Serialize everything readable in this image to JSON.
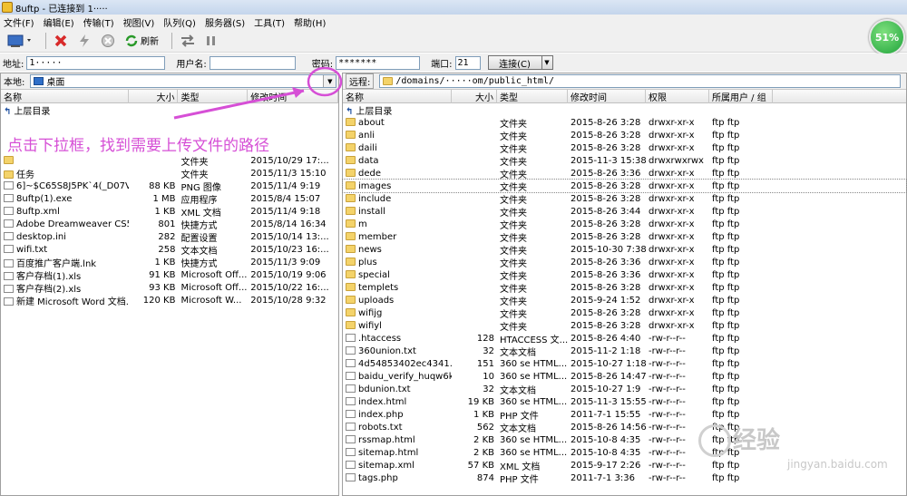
{
  "window": {
    "title": "8uftp - 已连接到 1·····"
  },
  "menu": [
    "文件(F)",
    "编辑(E)",
    "传输(T)",
    "视图(V)",
    "队列(Q)",
    "服务器(S)",
    "工具(T)",
    "帮助(H)"
  ],
  "toolbar": {
    "refresh_label": "刷新",
    "progress": "51%"
  },
  "connection": {
    "address_label": "地址:",
    "address_value": "1·····",
    "user_label": "用户名:",
    "user_value": "",
    "password_label": "密码:",
    "password_value": "*******",
    "port_label": "端口:",
    "port_value": "21",
    "connect_label": "连接(C)"
  },
  "local": {
    "label": "本地:",
    "path": "桌面",
    "columns": [
      "名称",
      "大小",
      "类型",
      "修改时间"
    ],
    "up_label": "上层目录",
    "files": [
      {
        "name": "",
        "size": "",
        "type": "文件夹",
        "date": "2015/10/29 17:..."
      },
      {
        "name": "任务",
        "size": "",
        "type": "文件夹",
        "date": "2015/11/3 15:10"
      },
      {
        "name": "6]~$C65S8J5PK`4(_D07V4...",
        "size": "88 KB",
        "type": "PNG 图像",
        "date": "2015/11/4 9:19"
      },
      {
        "name": "8uftp(1).exe",
        "size": "1 MB",
        "type": "应用程序",
        "date": "2015/8/4 15:07"
      },
      {
        "name": "8uftp.xml",
        "size": "1 KB",
        "type": "XML 文档",
        "date": "2015/11/4 9:18"
      },
      {
        "name": "Adobe Dreamweaver CS5...",
        "size": "801",
        "type": "快捷方式",
        "date": "2015/8/14 16:34"
      },
      {
        "name": "desktop.ini",
        "size": "282",
        "type": "配置设置",
        "date": "2015/10/14 13:..."
      },
      {
        "name": "wifi.txt",
        "size": "258",
        "type": "文本文档",
        "date": "2015/10/23 16:..."
      },
      {
        "name": "百度推广客户端.lnk",
        "size": "1 KB",
        "type": "快捷方式",
        "date": "2015/11/3 9:09"
      },
      {
        "name": "客户存档(1).xls",
        "size": "91 KB",
        "type": "Microsoft Off...",
        "date": "2015/10/19 9:06"
      },
      {
        "name": "客户存档(2).xls",
        "size": "93 KB",
        "type": "Microsoft Off...",
        "date": "2015/10/22 16:..."
      },
      {
        "name": "新建 Microsoft Word 文档...",
        "size": "120 KB",
        "type": "Microsoft W...",
        "date": "2015/10/28 9:32"
      }
    ]
  },
  "remote": {
    "label": "远程:",
    "path": "/domains/·····om/public_html/",
    "columns": [
      "名称",
      "大小",
      "类型",
      "修改时间",
      "权限",
      "所属用户 / 组"
    ],
    "up_label": "上层目录",
    "files": [
      {
        "name": "about",
        "size": "",
        "type": "文件夹",
        "date": "2015-8-26 3:28",
        "perm": "drwxr-xr-x",
        "owner": "ftp ftp",
        "folder": true
      },
      {
        "name": "anli",
        "size": "",
        "type": "文件夹",
        "date": "2015-8-26 3:28",
        "perm": "drwxr-xr-x",
        "owner": "ftp ftp",
        "folder": true
      },
      {
        "name": "daili",
        "size": "",
        "type": "文件夹",
        "date": "2015-8-26 3:28",
        "perm": "drwxr-xr-x",
        "owner": "ftp ftp",
        "folder": true
      },
      {
        "name": "data",
        "size": "",
        "type": "文件夹",
        "date": "2015-11-3 15:38",
        "perm": "drwxrwxrwx",
        "owner": "ftp ftp",
        "folder": true
      },
      {
        "name": "dede",
        "size": "",
        "type": "文件夹",
        "date": "2015-8-26 3:36",
        "perm": "drwxr-xr-x",
        "owner": "ftp ftp",
        "folder": true
      },
      {
        "name": "images",
        "size": "",
        "type": "文件夹",
        "date": "2015-8-26 3:28",
        "perm": "drwxr-xr-x",
        "owner": "ftp ftp",
        "folder": true
      },
      {
        "name": "include",
        "size": "",
        "type": "文件夹",
        "date": "2015-8-26 3:28",
        "perm": "drwxr-xr-x",
        "owner": "ftp ftp",
        "folder": true
      },
      {
        "name": "install",
        "size": "",
        "type": "文件夹",
        "date": "2015-8-26 3:44",
        "perm": "drwxr-xr-x",
        "owner": "ftp ftp",
        "folder": true
      },
      {
        "name": "m",
        "size": "",
        "type": "文件夹",
        "date": "2015-8-26 3:28",
        "perm": "drwxr-xr-x",
        "owner": "ftp ftp",
        "folder": true
      },
      {
        "name": "member",
        "size": "",
        "type": "文件夹",
        "date": "2015-8-26 3:28",
        "perm": "drwxr-xr-x",
        "owner": "ftp ftp",
        "folder": true
      },
      {
        "name": "news",
        "size": "",
        "type": "文件夹",
        "date": "2015-10-30 7:38",
        "perm": "drwxr-xr-x",
        "owner": "ftp ftp",
        "folder": true
      },
      {
        "name": "plus",
        "size": "",
        "type": "文件夹",
        "date": "2015-8-26 3:36",
        "perm": "drwxr-xr-x",
        "owner": "ftp ftp",
        "folder": true
      },
      {
        "name": "special",
        "size": "",
        "type": "文件夹",
        "date": "2015-8-26 3:36",
        "perm": "drwxr-xr-x",
        "owner": "ftp ftp",
        "folder": true
      },
      {
        "name": "templets",
        "size": "",
        "type": "文件夹",
        "date": "2015-8-26 3:28",
        "perm": "drwxr-xr-x",
        "owner": "ftp ftp",
        "folder": true
      },
      {
        "name": "uploads",
        "size": "",
        "type": "文件夹",
        "date": "2015-9-24 1:52",
        "perm": "drwxr-xr-x",
        "owner": "ftp ftp",
        "folder": true
      },
      {
        "name": "wifijg",
        "size": "",
        "type": "文件夹",
        "date": "2015-8-26 3:28",
        "perm": "drwxr-xr-x",
        "owner": "ftp ftp",
        "folder": true
      },
      {
        "name": "wifiyl",
        "size": "",
        "type": "文件夹",
        "date": "2015-8-26 3:28",
        "perm": "drwxr-xr-x",
        "owner": "ftp ftp",
        "folder": true
      },
      {
        "name": ".htaccess",
        "size": "128",
        "type": "HTACCESS 文...",
        "date": "2015-8-26 4:40",
        "perm": "-rw-r--r--",
        "owner": "ftp ftp",
        "folder": false
      },
      {
        "name": "360union.txt",
        "size": "32",
        "type": "文本文档",
        "date": "2015-11-2 1:18",
        "perm": "-rw-r--r--",
        "owner": "ftp ftp",
        "folder": false
      },
      {
        "name": "4d54853402ec4341...",
        "size": "151",
        "type": "360 se HTML...",
        "date": "2015-10-27 1:18",
        "perm": "-rw-r--r--",
        "owner": "ftp ftp",
        "folder": false
      },
      {
        "name": "baidu_verify_huqw6k...",
        "size": "10",
        "type": "360 se HTML...",
        "date": "2015-8-26 14:47",
        "perm": "-rw-r--r--",
        "owner": "ftp ftp",
        "folder": false
      },
      {
        "name": "bdunion.txt",
        "size": "32",
        "type": "文本文档",
        "date": "2015-10-27 1:9",
        "perm": "-rw-r--r--",
        "owner": "ftp ftp",
        "folder": false
      },
      {
        "name": "index.html",
        "size": "19 KB",
        "type": "360 se HTML...",
        "date": "2015-11-3 15:55",
        "perm": "-rw-r--r--",
        "owner": "ftp ftp",
        "folder": false
      },
      {
        "name": "index.php",
        "size": "1 KB",
        "type": "PHP 文件",
        "date": "2011-7-1 15:55",
        "perm": "-rw-r--r--",
        "owner": "ftp ftp",
        "folder": false
      },
      {
        "name": "robots.txt",
        "size": "562",
        "type": "文本文档",
        "date": "2015-8-26 14:56",
        "perm": "-rw-r--r--",
        "owner": "ftp ftp",
        "folder": false
      },
      {
        "name": "rssmap.html",
        "size": "2 KB",
        "type": "360 se HTML...",
        "date": "2015-10-8 4:35",
        "perm": "-rw-r--r--",
        "owner": "ftp ftp",
        "folder": false
      },
      {
        "name": "sitemap.html",
        "size": "2 KB",
        "type": "360 se HTML...",
        "date": "2015-10-8 4:35",
        "perm": "-rw-r--r--",
        "owner": "ftp ftp",
        "folder": false
      },
      {
        "name": "sitemap.xml",
        "size": "57 KB",
        "type": "XML 文档",
        "date": "2015-9-17 2:26",
        "perm": "-rw-r--r--",
        "owner": "ftp ftp",
        "folder": false
      },
      {
        "name": "tags.php",
        "size": "874",
        "type": "PHP 文件",
        "date": "2011-7-1 3:36",
        "perm": "-rw-r--r--",
        "owner": "ftp ftp",
        "folder": false
      }
    ]
  },
  "annotation": {
    "text": "点击下拉框，找到需要上传文件的路径",
    "color": "#d64fd6"
  },
  "watermark": {
    "brand": "经验",
    "url": "jingyan.baidu.com"
  }
}
